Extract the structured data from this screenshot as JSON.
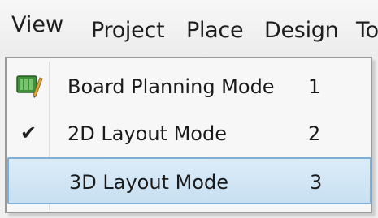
{
  "menubar": {
    "items": [
      {
        "label": "View"
      },
      {
        "label": "Project"
      },
      {
        "label": "Place"
      },
      {
        "label": "Design"
      },
      {
        "label": "To"
      }
    ]
  },
  "menu": {
    "items": [
      {
        "label": "Board Planning Mode",
        "shortcut": "1",
        "icon": "board-planning-icon",
        "checked": false
      },
      {
        "label": "2D Layout Mode",
        "shortcut": "2",
        "icon": "checkmark-icon",
        "checked": true
      },
      {
        "label": "3D Layout Mode",
        "shortcut": "3",
        "icon": "",
        "checked": false,
        "highlighted": true
      }
    ],
    "check_glyph": "✔"
  },
  "colors": {
    "highlight_fill": "#c8e0f2",
    "highlight_border": "#7fb0da",
    "menu_bg": "#f7f7f7"
  }
}
